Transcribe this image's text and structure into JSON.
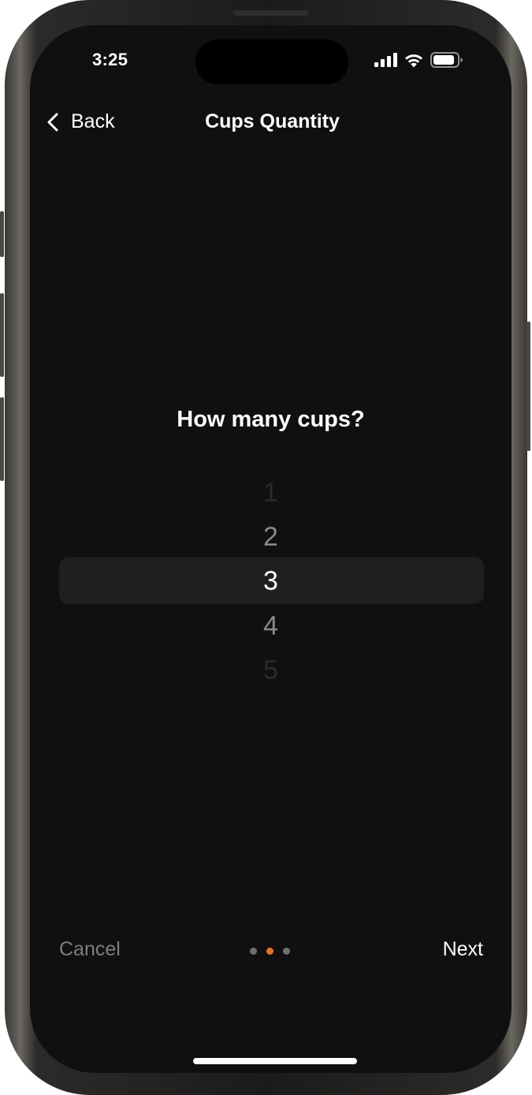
{
  "status_bar": {
    "time": "3:25",
    "icons": [
      "cellular-signal-icon",
      "wifi-icon",
      "battery-icon"
    ]
  },
  "nav": {
    "back_icon": "chevron-left-icon",
    "back_label": "Back",
    "title": "Cups Quantity"
  },
  "main": {
    "question": "How many cups?",
    "picker": {
      "options": [
        "1",
        "2",
        "3",
        "4",
        "5"
      ],
      "selected": "3"
    }
  },
  "footer": {
    "cancel_label": "Cancel",
    "next_label": "Next",
    "pagination": {
      "total": 3,
      "current": 2
    }
  },
  "colors": {
    "background": "#101010",
    "accent": "#E8742A",
    "picker_highlight": "#1F1F1F",
    "muted_text": "#7E7E7E"
  }
}
